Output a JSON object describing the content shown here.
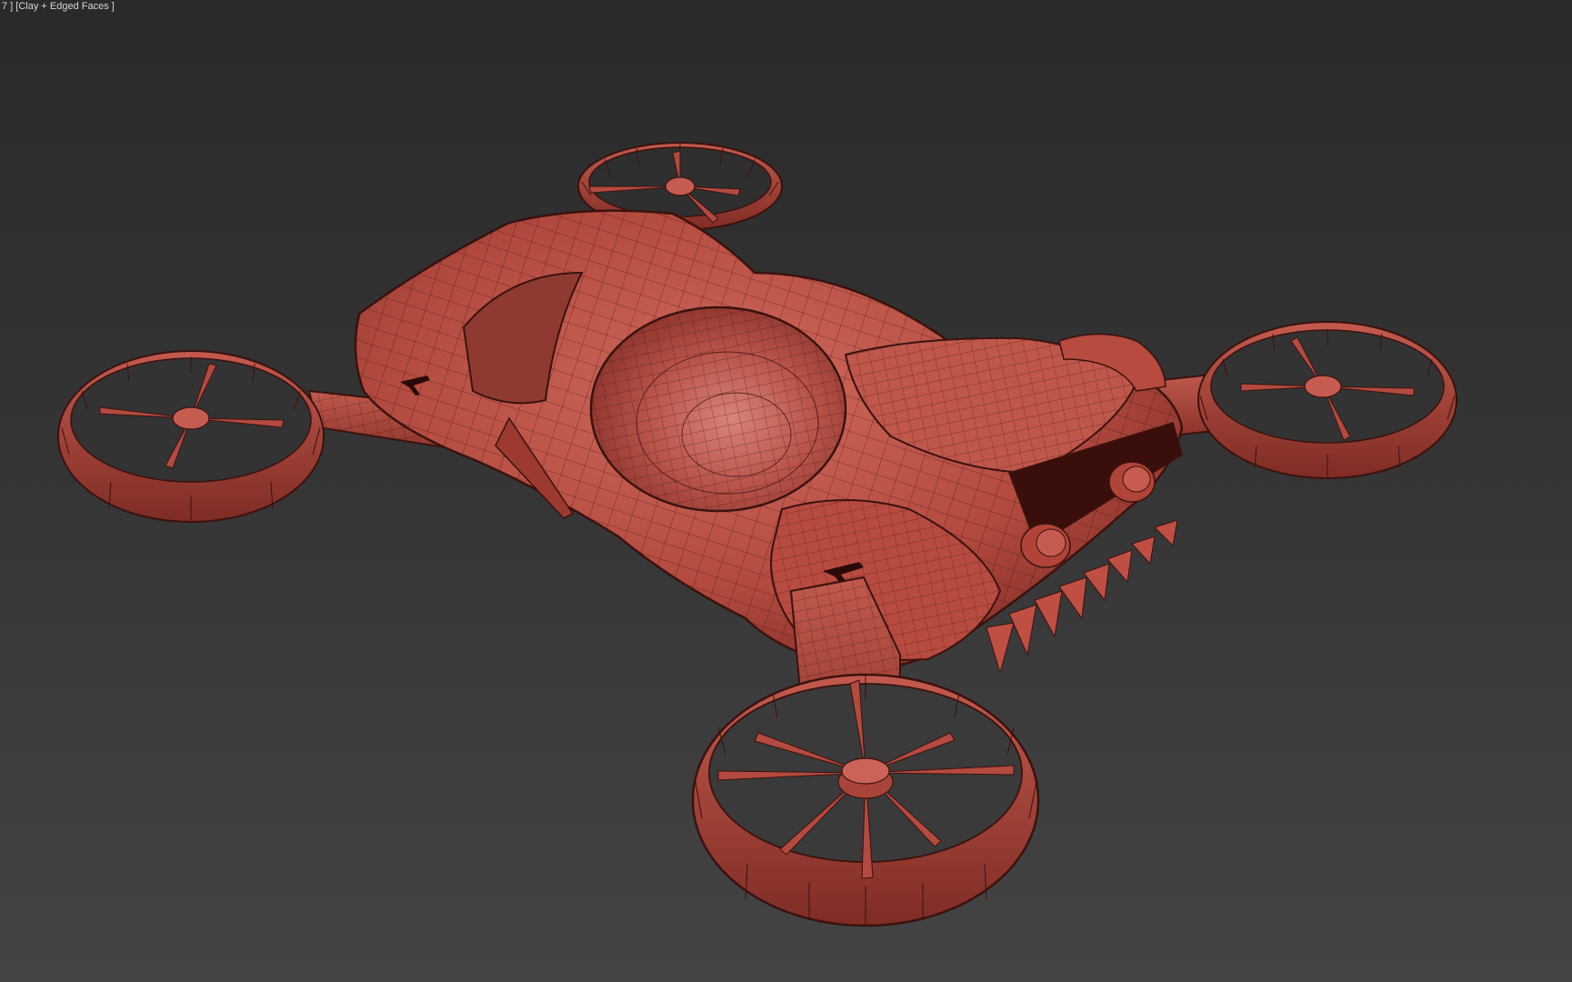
{
  "viewport": {
    "label": "7 ] [Clay + Edged Faces ]",
    "model": "drone-mesh"
  },
  "colors": {
    "background_top": "#2a2a2a",
    "background_bottom": "#444444",
    "clay": "#b84b40",
    "clay_light": "#cf6a5c",
    "clay_dark": "#6e241d",
    "edge": "#3a120e"
  }
}
